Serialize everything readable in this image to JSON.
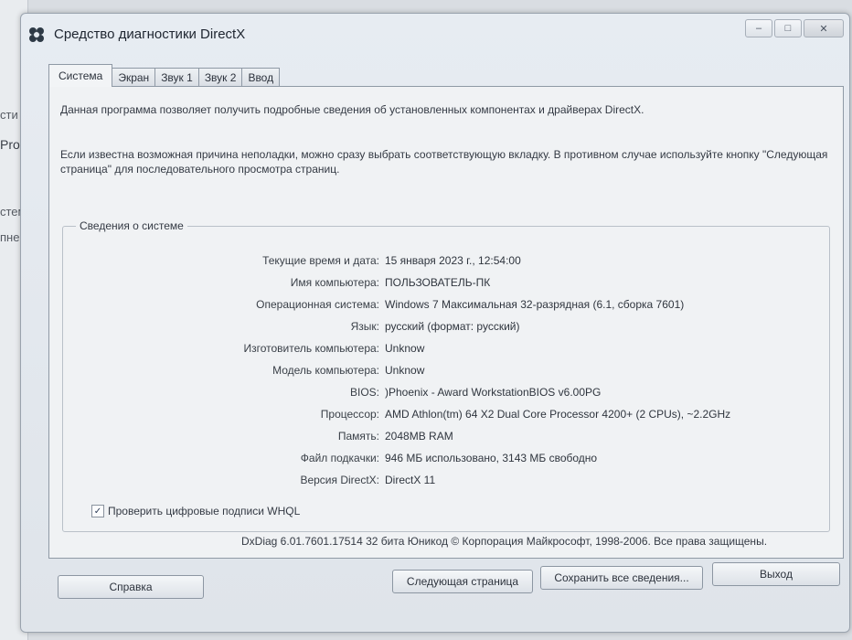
{
  "background": {
    "fragments": [
      "сти",
      "Pro",
      "стем",
      "пне"
    ]
  },
  "window": {
    "title": "Средство диагностики DirectX",
    "controls": {
      "minimize": "–",
      "maximize": "□",
      "close": "✕"
    }
  },
  "tabs": [
    {
      "label": "Система",
      "active": true
    },
    {
      "label": "Экран",
      "active": false
    },
    {
      "label": "Звук 1",
      "active": false
    },
    {
      "label": "Звук 2",
      "active": false
    },
    {
      "label": "Ввод",
      "active": false
    }
  ],
  "intro": {
    "line1": "Данная программа позволяет получить подробные сведения об установленных компонентах и драйверах DirectX.",
    "line2": "Если известна возможная причина неполадки, можно сразу выбрать соответствующую вкладку. В противном случае используйте кнопку \"Следующая страница\" для последовательного просмотра страниц."
  },
  "system_info": {
    "title": "Сведения о системе",
    "rows": [
      {
        "label": "Текущие время и дата:",
        "value": "15 января 2023 г., 12:54:00"
      },
      {
        "label": "Имя компьютера:",
        "value": "ПОЛЬЗОВАТЕЛЬ-ПК"
      },
      {
        "label": "Операционная система:",
        "value": "Windows 7 Максимальная 32-разрядная (6.1, сборка 7601)"
      },
      {
        "label": "Язык:",
        "value": "русский (формат: русский)"
      },
      {
        "label": "Изготовитель компьютера:",
        "value": "Unknow"
      },
      {
        "label": "Модель компьютера:",
        "value": "Unknow"
      },
      {
        "label": "BIOS:",
        "value": ")Phoenix - Award WorkstationBIOS v6.00PG"
      },
      {
        "label": "Процессор:",
        "value": "AMD Athlon(tm) 64 X2 Dual Core Processor 4200+ (2 CPUs), ~2.2GHz"
      },
      {
        "label": "Память:",
        "value": "2048MB RAM"
      },
      {
        "label": "Файл подкачки:",
        "value": "946 МБ использовано, 3143 МБ свободно"
      },
      {
        "label": "Версия DirectX:",
        "value": "DirectX 11"
      }
    ]
  },
  "whql": {
    "label": "Проверить цифровые подписи WHQL",
    "checked": true,
    "mark": "✓"
  },
  "footer": "DxDiag 6.01.7601.17514 32 бита Юникод  © Корпорация Майкрософт, 1998-2006.  Все права защищены.",
  "buttons": {
    "help": "Справка",
    "next": "Следующая страница",
    "save": "Сохранить все сведения...",
    "exit": "Выход"
  }
}
